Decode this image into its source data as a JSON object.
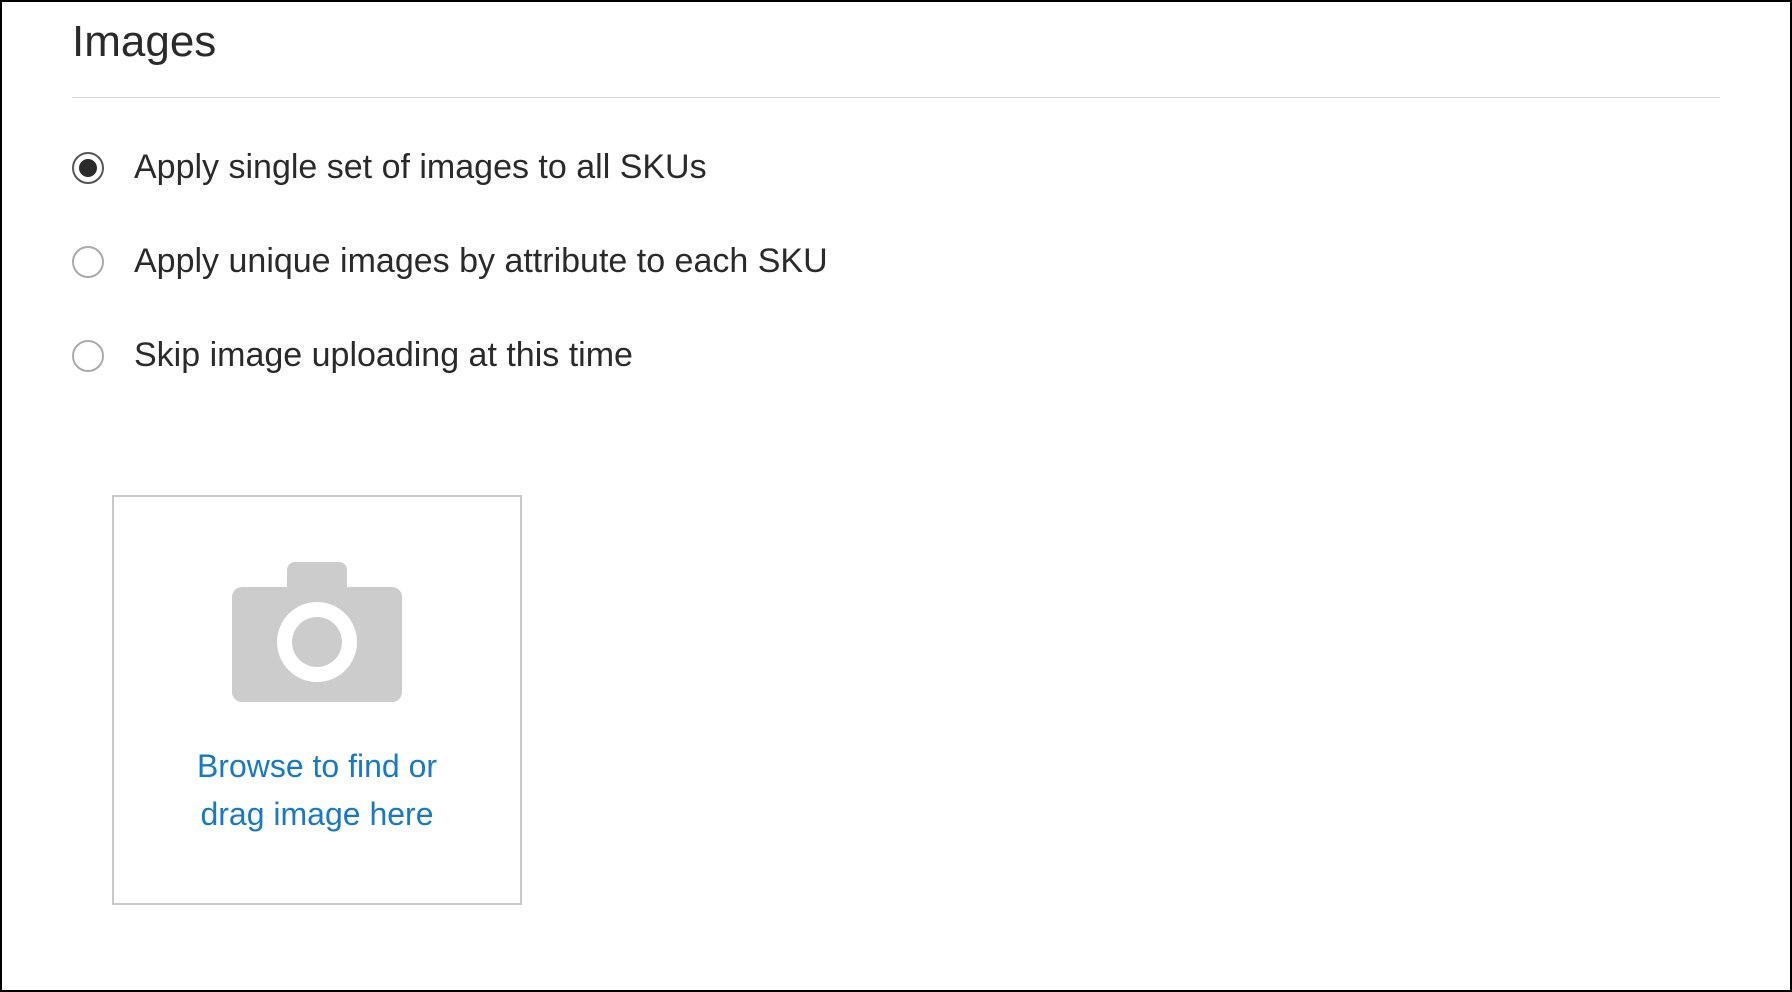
{
  "section": {
    "title": "Images"
  },
  "radios": {
    "selected_index": 0,
    "options": [
      {
        "label": "Apply single set of images to all SKUs"
      },
      {
        "label": "Apply unique images by attribute to each SKU"
      },
      {
        "label": "Skip image uploading at this time"
      }
    ]
  },
  "upload": {
    "line1": "Browse to find or",
    "line2": "drag image here"
  }
}
